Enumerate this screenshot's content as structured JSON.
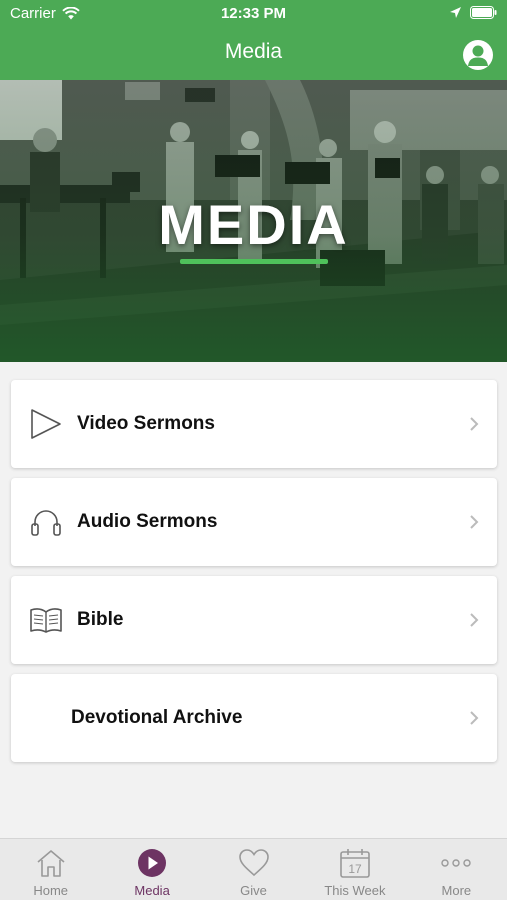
{
  "status_bar": {
    "carrier": "Carrier",
    "time": "12:33 PM"
  },
  "nav": {
    "title": "Media",
    "profile_icon": "person-icon"
  },
  "hero": {
    "title": "MEDIA",
    "accent_color": "#4fc15b"
  },
  "menu": {
    "items": [
      {
        "label": "Video Sermons",
        "icon": "play-outline-icon"
      },
      {
        "label": "Audio Sermons",
        "icon": "headphones-icon"
      },
      {
        "label": "Bible",
        "icon": "open-book-icon"
      },
      {
        "label": "Devotional Archive",
        "icon": ""
      }
    ]
  },
  "tabbar": {
    "tabs": [
      {
        "label": "Home",
        "icon": "home-icon",
        "active": false
      },
      {
        "label": "Media",
        "icon": "play-circle-icon",
        "active": true
      },
      {
        "label": "Give",
        "icon": "heart-icon",
        "active": false
      },
      {
        "label": "This Week",
        "icon": "calendar-icon",
        "active": false,
        "calendar_day": "17"
      },
      {
        "label": "More",
        "icon": "more-dots-icon",
        "active": false
      }
    ]
  },
  "colors": {
    "brand_green": "#4caa55",
    "active_tab": "#6d3463",
    "inactive_tab": "#888888"
  }
}
